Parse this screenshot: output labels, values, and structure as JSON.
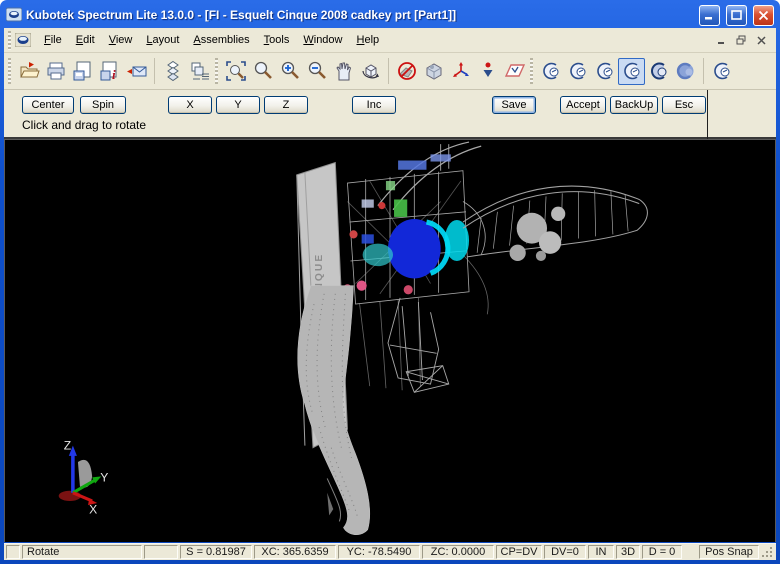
{
  "window": {
    "title": "Kubotek Spectrum Lite 13.0.0 - [FI - Esquelt Cinque 2008 cadkey prt [Part1]]",
    "titlebar_buttons": [
      "minimize",
      "maximize",
      "close"
    ],
    "mdi_buttons": [
      "mdi-minimize",
      "mdi-restore",
      "mdi-close"
    ]
  },
  "menubar": {
    "items": [
      {
        "label": "File",
        "m": 0
      },
      {
        "label": "Edit",
        "m": 0
      },
      {
        "label": "View",
        "m": 0
      },
      {
        "label": "Layout",
        "m": 0
      },
      {
        "label": "Assemblies",
        "m": 0
      },
      {
        "label": "Tools",
        "m": 0
      },
      {
        "label": "Window",
        "m": 0
      },
      {
        "label": "Help",
        "m": 0
      }
    ]
  },
  "toolbar": {
    "groups": [
      {
        "grip": true,
        "items": [
          {
            "name": "open-file-icon",
            "sym": "folder"
          },
          {
            "name": "print-icon",
            "sym": "printer"
          },
          {
            "name": "save-copy-icon",
            "sym": "docdisk"
          },
          {
            "name": "file-properties-icon",
            "sym": "docinfo"
          },
          {
            "name": "send-mail-icon",
            "sym": "mail"
          }
        ]
      },
      {
        "sep": true,
        "items": [
          {
            "name": "levels-icon",
            "sym": "layers"
          },
          {
            "name": "level-manager-icon",
            "sym": "layers2"
          }
        ]
      },
      {
        "grip": true,
        "items": [
          {
            "name": "zoom-window-icon",
            "sym": "zoomwin"
          },
          {
            "name": "zoom-scale-icon",
            "sym": "mag"
          },
          {
            "name": "zoom-in-icon",
            "sym": "magplus"
          },
          {
            "name": "zoom-out-icon",
            "sym": "magminus"
          },
          {
            "name": "pan-icon",
            "sym": "hand"
          },
          {
            "name": "rotate-view-icon",
            "sym": "cuberot"
          }
        ]
      },
      {
        "sep": true,
        "items": [
          {
            "name": "section-toggle-icon",
            "sym": "nosection"
          },
          {
            "name": "shaded-view-icon",
            "sym": "cube"
          }
        ]
      },
      {
        "items": [
          {
            "name": "axes-triad-icon",
            "sym": "triad"
          },
          {
            "name": "axes-dropdown-icon",
            "sym": "drop"
          },
          {
            "name": "view-plane-icon",
            "sym": "plane"
          }
        ]
      },
      {
        "grip": true,
        "items": [
          {
            "name": "dynaview-1-icon",
            "sym": "dv"
          },
          {
            "name": "dynaview-2-icon",
            "sym": "dv"
          },
          {
            "name": "dynaview-3-icon",
            "sym": "dv"
          },
          {
            "name": "dynaview-4-icon",
            "sym": "dv",
            "sel": true
          },
          {
            "name": "dynaview-5-icon",
            "sym": "dv2"
          },
          {
            "name": "dynaview-6-icon",
            "sym": "dv3"
          }
        ]
      },
      {
        "sep": true,
        "items": [
          {
            "name": "dynaview-7-icon",
            "sym": "dv"
          }
        ]
      }
    ]
  },
  "panel": {
    "buttons": {
      "center": "Center",
      "spin": "Spin",
      "x": "X",
      "y": "Y",
      "z": "Z",
      "inc": "Inc",
      "save": "Save",
      "accept": "Accept",
      "backup": "BackUp",
      "esc": "Esc"
    },
    "prompt": "Click and drag to rotate"
  },
  "viewport": {
    "background": "#000000",
    "plate_text": "ESQUELT CINQUE",
    "axis_labels": {
      "z": "Z",
      "y": "Y",
      "x": "X"
    }
  },
  "statusbar": {
    "cells": [
      "Rotate",
      "",
      "S = 0.81987",
      "XC: 365.6359",
      "YC: -78.5490",
      "ZC: 0.0000",
      "CP=DV",
      "DV=0",
      "IN",
      "3D",
      "D = 0",
      "Pos Snap"
    ]
  },
  "colors": {
    "titlebar_blue": "#0f50cc",
    "face": "#ece9d8",
    "button_border": "#003c74",
    "viewport_bg": "#000000",
    "axis_z": "#2238e8",
    "axis_y": "#10a810",
    "axis_x": "#cc1515",
    "model_wire": "#a6a6a6",
    "highlight_blue": "#1228d8",
    "highlight_cyan": "#00dcf0"
  }
}
